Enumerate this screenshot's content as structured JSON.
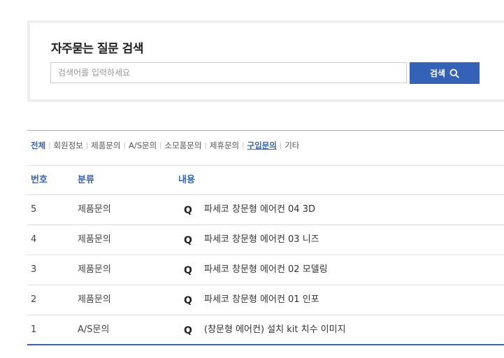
{
  "search": {
    "title": "자주묻는 질문 검색",
    "placeholder": "검색어를 입력하세요",
    "value": "",
    "button_label": "검색",
    "button_icon": "search-icon"
  },
  "categories": [
    {
      "label": "전체",
      "state": "active-first"
    },
    {
      "label": "회원정보",
      "state": ""
    },
    {
      "label": "제품문의",
      "state": ""
    },
    {
      "label": "A/S문의",
      "state": ""
    },
    {
      "label": "소모품문의",
      "state": ""
    },
    {
      "label": "제휴문의",
      "state": ""
    },
    {
      "label": "구입문의",
      "state": "active-sel"
    },
    {
      "label": "기타",
      "state": ""
    }
  ],
  "table": {
    "headers": {
      "no": "번호",
      "category": "분류",
      "content": "내용"
    },
    "rows": [
      {
        "no": "5",
        "category": "제품문의",
        "q": "Q",
        "title": "파세코 창문형 에어컨 04 3D"
      },
      {
        "no": "4",
        "category": "제품문의",
        "q": "Q",
        "title": "파세코 창문형 에어컨 03 니즈"
      },
      {
        "no": "3",
        "category": "제품문의",
        "q": "Q",
        "title": "파세코 창문형 에어컨 02 모델링"
      },
      {
        "no": "2",
        "category": "제품문의",
        "q": "Q",
        "title": "파세코 창문형 에어컨 01 인포"
      },
      {
        "no": "1",
        "category": "A/S문의",
        "q": "Q",
        "title": "(창문형 에어컨) 설치 kit 치수 이미지"
      }
    ]
  },
  "colors": {
    "accent": "#3462b7",
    "border": "#dddddd",
    "box_border": "#eeeeee"
  }
}
